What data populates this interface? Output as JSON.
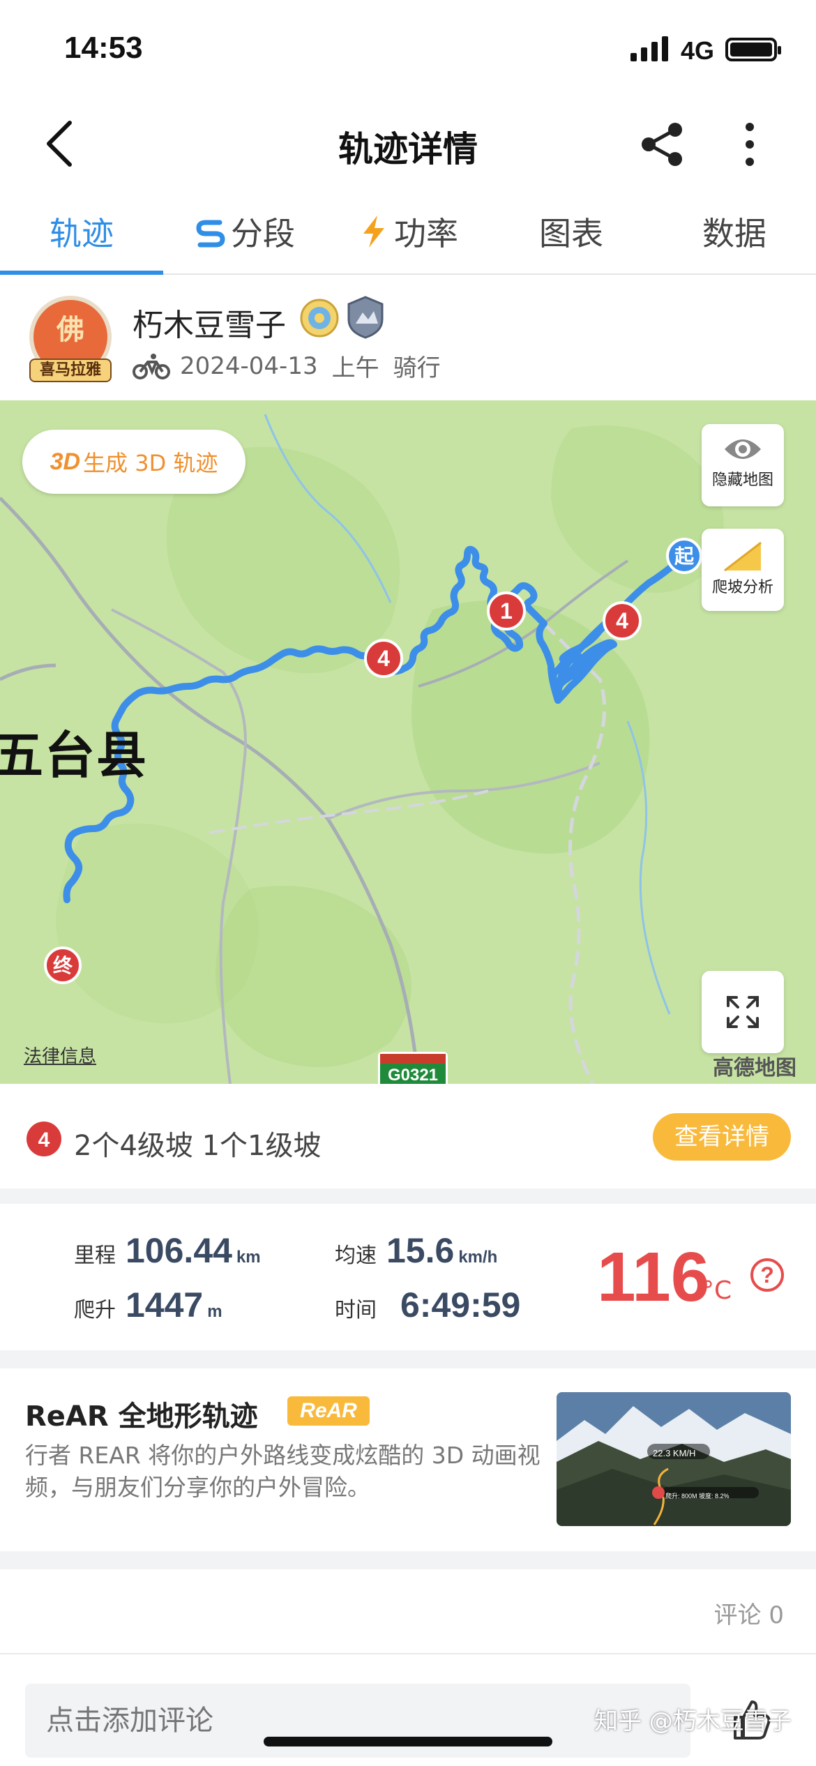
{
  "status": {
    "time": "14:53",
    "network": "4G"
  },
  "nav": {
    "title": "轨迹详情"
  },
  "tabs": [
    {
      "label": "轨迹",
      "icon": ""
    },
    {
      "label": "分段",
      "icon": "segment-icon"
    },
    {
      "label": "功率",
      "icon": "lightning-icon"
    },
    {
      "label": "图表",
      "icon": ""
    },
    {
      "label": "数据",
      "icon": ""
    }
  ],
  "user": {
    "name": "朽木豆雪子",
    "avatar_char": "佛",
    "avatar_badge": "喜马拉雅",
    "date": "2024-04-13",
    "period": "上午",
    "activity": "骑行"
  },
  "map": {
    "btn3d_prefix": "3D",
    "btn3d_label": "生成 3D 轨迹",
    "hide_map": "隐藏地图",
    "climb_analysis": "爬坡分析",
    "place_name": "五台县",
    "start_marker": "起",
    "end_marker": "终",
    "climb_markers": [
      "1",
      "4",
      "4"
    ],
    "legal": "法律信息",
    "provider": "高德地图",
    "road": "G0321",
    "colors": {
      "route": "#3c8ee8",
      "terrain": "#c6e3a3",
      "marker": "#d93a3a"
    }
  },
  "climb": {
    "badge": "4",
    "summary": "2个4级坡 1个1级坡",
    "detail_button": "查看详情"
  },
  "stats": {
    "distance": {
      "label": "里程",
      "value": "106.44",
      "unit": "km"
    },
    "speed": {
      "label": "均速",
      "value": "15.6",
      "unit": "km/h"
    },
    "climb": {
      "label": "爬升",
      "value": "1447",
      "unit": "m"
    },
    "time": {
      "label": "时间",
      "value": "6:49:59"
    },
    "temperature": {
      "value": "116",
      "unit": "°C"
    }
  },
  "rear": {
    "title": "ReAR 全地形轨迹",
    "badge": "ReAR",
    "desc": "行者 REAR 将你的户外路线变成炫酷的 3D 动画视频，与朋友们分享你的户外冒险。",
    "thumb_speed": "22.3 KM/H",
    "thumb_info": "爬升: 800M 坡度: 8.2%"
  },
  "comments": {
    "count_label": "评论 0",
    "placeholder": "点击添加评论"
  },
  "watermark": "知乎 @朽木豆雪子"
}
